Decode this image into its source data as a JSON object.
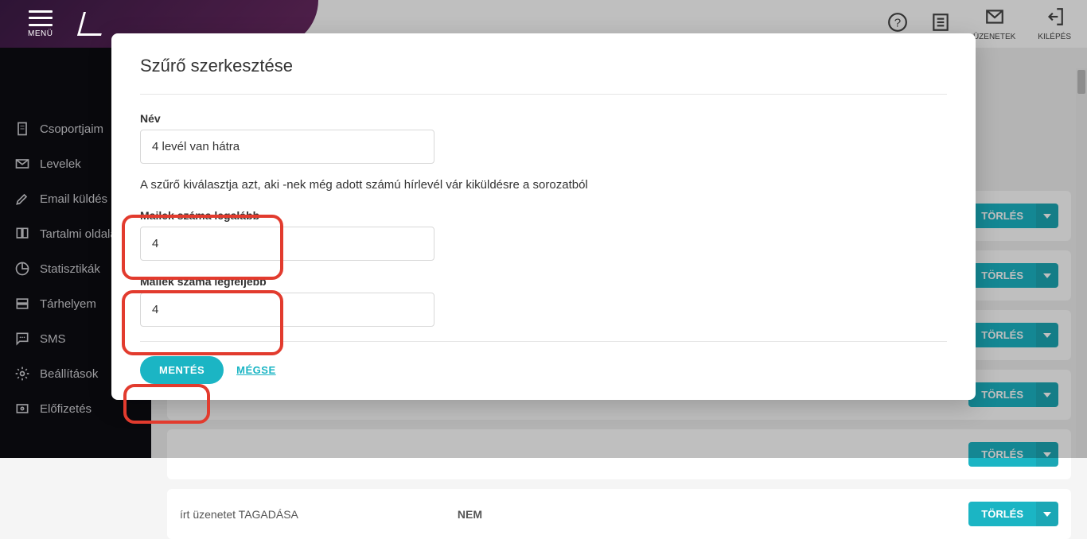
{
  "header": {
    "menu_label": "MENÜ",
    "right": {
      "uzenetek": "ÜZENETEK",
      "kilepes": "KILÉPÉS"
    }
  },
  "sidebar": {
    "items": [
      {
        "label": "Csoportjaim"
      },
      {
        "label": "Levelek"
      },
      {
        "label": "Email küldés"
      },
      {
        "label": "Tartalmi oldalak"
      },
      {
        "label": "Statisztikák"
      },
      {
        "label": "Tárhelyem"
      },
      {
        "label": "SMS"
      },
      {
        "label": "Beállítások"
      },
      {
        "label": "Előfizetés"
      }
    ]
  },
  "background": {
    "row_text": "írt üzenetet TAGADÁSA",
    "row_sub": "NEM",
    "pill_label": "TÖRLÉS"
  },
  "modal": {
    "title": "Szűrő szerkesztése",
    "name_label": "Név",
    "name_value": "4 levél van hátra",
    "description": "A szűrő kiválasztja azt, aki -nek még adott számú hírlevél vár kiküldésre a sorozatból",
    "min_label": "Mailek száma legalább",
    "min_value": "4",
    "max_label": "Mailek száma legfeljebb",
    "max_value": "4",
    "save": "MENTÉS",
    "cancel": "MÉGSE"
  }
}
